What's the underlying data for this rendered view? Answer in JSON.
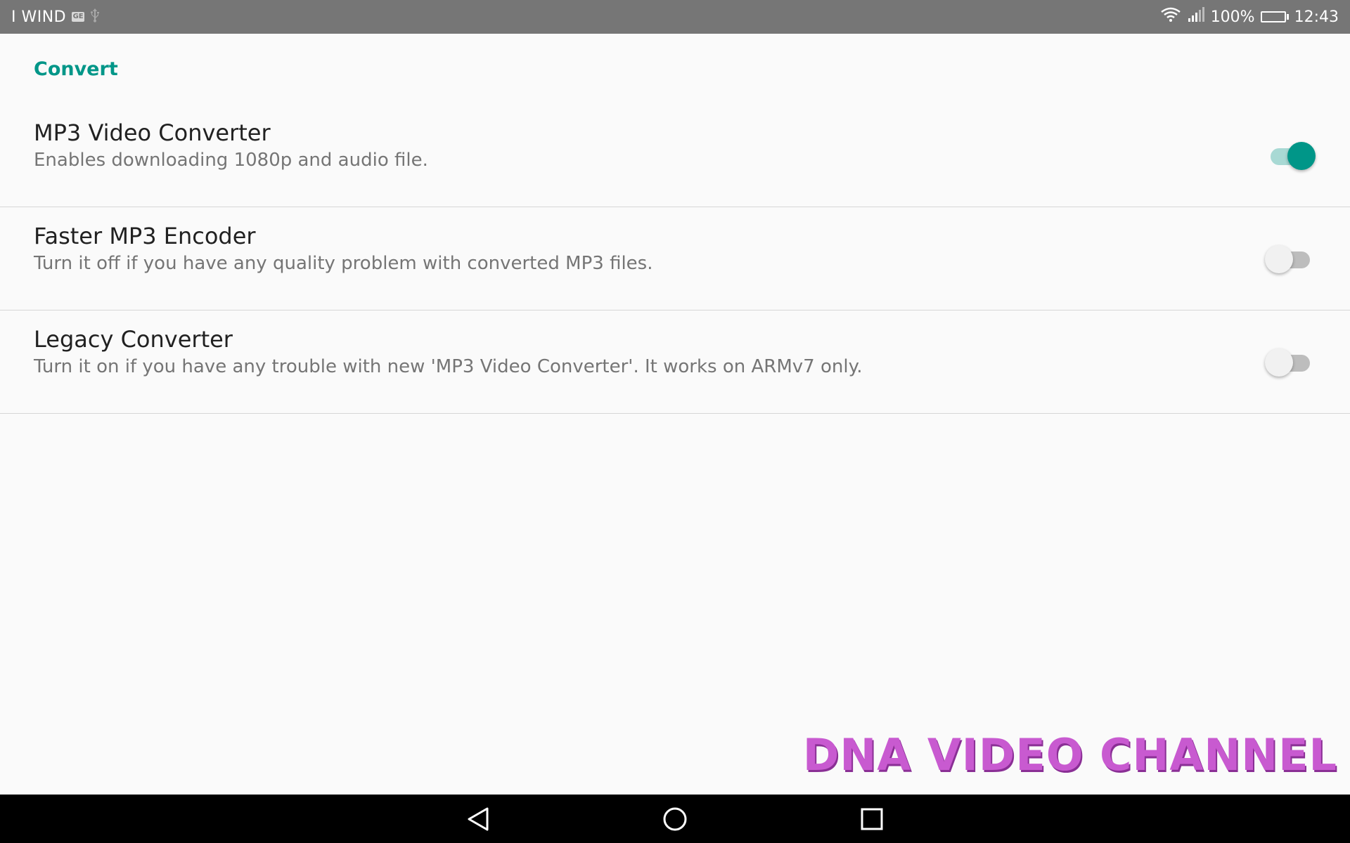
{
  "status_bar": {
    "carrier": "I WIND",
    "sim_icon_label": "GE",
    "battery_percent": "100%",
    "battery_level": 1.0,
    "time": "12:43"
  },
  "section": {
    "title": "Convert"
  },
  "preferences": [
    {
      "title": "MP3 Video Converter",
      "summary": "Enables downloading 1080p and audio file.",
      "enabled": true
    },
    {
      "title": "Faster MP3 Encoder",
      "summary": "Turn it off if you have any quality problem with converted MP3 files.",
      "enabled": false
    },
    {
      "title": "Legacy Converter",
      "summary": "Turn it on if you have any trouble with new 'MP3 Video Converter'. It works on ARMv7 only.",
      "enabled": false
    }
  ],
  "watermark": "DNA VIDEO CHANNEL",
  "colors": {
    "accent": "#009688",
    "status_bar": "#767676",
    "nav_bar": "#000000",
    "watermark": "#c85ad0"
  },
  "icons": {
    "wifi": "wifi-icon",
    "signal": "signal-icon",
    "battery": "battery-icon",
    "usb": "usb-icon",
    "back": "back-icon",
    "home": "home-icon",
    "recents": "recents-icon"
  }
}
